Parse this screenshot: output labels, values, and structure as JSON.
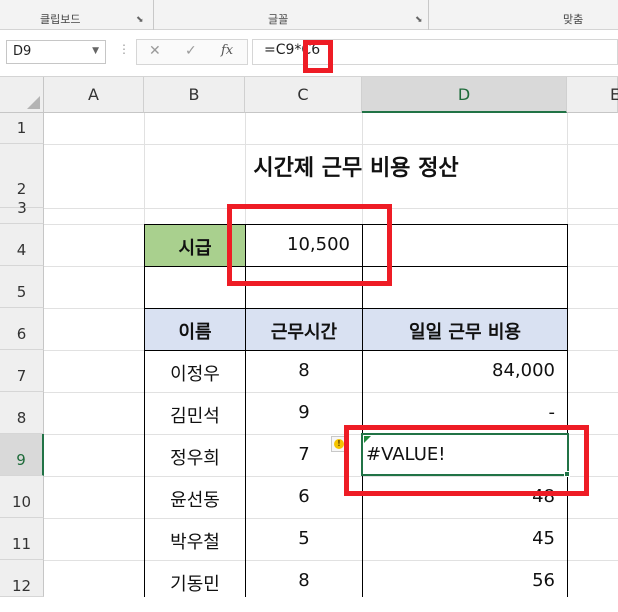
{
  "ribbon": {
    "groups": [
      "클립보드",
      "글꼴",
      "맞춤"
    ]
  },
  "formula_bar": {
    "name_box": "D9",
    "cancel_icon": "✕",
    "enter_icon": "✓",
    "fx_label": "fx",
    "formula": "=C9*C6"
  },
  "columns": [
    "A",
    "B",
    "C",
    "D",
    "E"
  ],
  "rows": [
    "1",
    "2",
    "3",
    "4",
    "5",
    "6",
    "7",
    "8",
    "9",
    "10",
    "11",
    "12"
  ],
  "sheet": {
    "title": "시간제 근무 비용 정산",
    "rate_label": "시급",
    "rate_value": "10,500",
    "headers": [
      "이름",
      "근무시간",
      "일일 근무 비용"
    ],
    "data_rows": [
      {
        "name": "이정우",
        "hours": "8",
        "cost": "84,000"
      },
      {
        "name": "김민석",
        "hours": "9",
        "cost": "-"
      },
      {
        "name": "정우희",
        "hours": "7",
        "cost": "#VALUE!"
      },
      {
        "name": "윤선동",
        "hours": "6",
        "cost": "48"
      },
      {
        "name": "박우철",
        "hours": "5",
        "cost": "45"
      },
      {
        "name": "기동민",
        "hours": "8",
        "cost": "56"
      }
    ]
  },
  "colors": {
    "rate_label_fill": "#a9d08e",
    "header_fill": "#d9e1f2",
    "selection": "#217346",
    "highlight": "#ee1c25",
    "error_indicator": "#1e8a3c"
  }
}
